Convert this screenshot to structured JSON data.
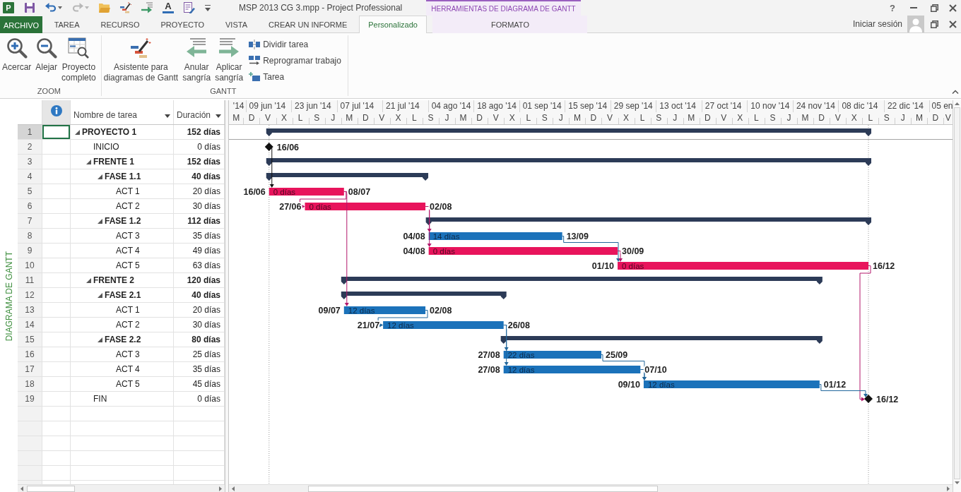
{
  "title_bar": {
    "quick_access": [
      {
        "kind": "app",
        "glyph": "P",
        "disabled": false
      },
      {
        "kind": "save",
        "disabled": false
      },
      {
        "kind": "undo",
        "disabled": false
      },
      {
        "kind": "redo",
        "disabled": true
      },
      {
        "kind": "open",
        "disabled": false
      },
      {
        "kind": "wizard",
        "disabled": false
      },
      {
        "kind": "indent",
        "disabled": false
      },
      {
        "kind": "fontcolor",
        "glyph": "A",
        "disabled": false
      },
      {
        "kind": "form",
        "disabled": false
      },
      {
        "kind": "customize",
        "disabled": false
      }
    ],
    "title": "MSP 2013 CG 3.mpp - Project Professional",
    "context_header": "HERRAMIENTAS DE DIAGRAMA DE GANTT",
    "help": "?"
  },
  "tabs": [
    {
      "label": "ARCHIVO",
      "kind": "file",
      "selected": false
    },
    {
      "label": "TAREA",
      "kind": "main",
      "selected": false
    },
    {
      "label": "RECURSO",
      "kind": "main",
      "selected": false
    },
    {
      "label": "PROYECTO",
      "kind": "main",
      "selected": false
    },
    {
      "label": "VISTA",
      "kind": "main",
      "selected": false
    },
    {
      "label": "CREAR UN INFORME",
      "kind": "main",
      "selected": false
    },
    {
      "label": "Personalizado",
      "kind": "main",
      "selected": true
    },
    {
      "label": "FORMATO",
      "kind": "context",
      "selected": false
    }
  ],
  "account": {
    "label": "Iniciar sesión"
  },
  "ribbon": {
    "groups": [
      {
        "label": "ZOOM",
        "buttons": [
          {
            "kind": "zoomin",
            "label": "Acercar"
          },
          {
            "kind": "zoomout",
            "label": "Alejar"
          },
          {
            "kind": "fit",
            "label": "Proyecto\ncompleto"
          }
        ]
      },
      {
        "label": "GANTT",
        "buttons": [
          {
            "kind": "wizard",
            "label": "Asistente para\ndiagramas de Gantt"
          },
          {
            "kind": "outdent",
            "label": "Anular\nsangría"
          },
          {
            "kind": "indent",
            "label": "Aplicar\nsangría"
          }
        ],
        "small_buttons": [
          {
            "kind": "split",
            "label": "Dividir tarea"
          },
          {
            "kind": "reschedule",
            "label": "Reprogramar trabajo"
          },
          {
            "kind": "task",
            "label": "Tarea"
          }
        ]
      }
    ]
  },
  "view_bar": {
    "label": "DIAGRAMA DE GANTT"
  },
  "table": {
    "columns": [
      {
        "kind": "info"
      },
      {
        "kind": "name",
        "label": "Nombre de tarea"
      },
      {
        "kind": "duration",
        "label": "Duración"
      }
    ]
  },
  "gantt": {
    "timescale": {
      "top": [
        "'14",
        "09 jun '14",
        "23 jun '14",
        "07 jul '14",
        "21 jul '14",
        "04 ago '14",
        "18 ago '14",
        "01 sep '14",
        "15 sep '14",
        "29 sep '14",
        "13 oct '14",
        "27 oct '14",
        "10 nov '14",
        "24 nov '14",
        "08 dic '14",
        "22 dic '14",
        "05 en"
      ],
      "bottom": [
        "M",
        "D",
        "V",
        "X",
        "L",
        "S",
        "J",
        "M",
        "D",
        "V",
        "X",
        "L",
        "S",
        "J",
        "M",
        "D",
        "V",
        "X",
        "L",
        "S",
        "J",
        "M",
        "D",
        "V",
        "X",
        "L",
        "S",
        "J",
        "M",
        "D",
        "V",
        "X",
        "L",
        "S",
        "J",
        "M",
        "D",
        "V",
        "X",
        "L",
        "S",
        "J",
        "M",
        "D",
        "V"
      ]
    }
  },
  "tasks": [
    {
      "row": "1",
      "kind": "summary",
      "name": "PROYECTO 1",
      "duration": "152 días",
      "expanded": true,
      "selected": true,
      "children": [
        {
          "row": "2",
          "kind": "milestone",
          "name": "INICIO",
          "duration": "0 días",
          "date_label": "16/06",
          "selected": false
        },
        {
          "row": "3",
          "kind": "summary",
          "name": "FRENTE 1",
          "duration": "152 días",
          "expanded": true,
          "selected": false,
          "children": [
            {
              "row": "4",
              "kind": "summary",
              "name": "FASE 1.1",
              "duration": "40 días",
              "expanded": true,
              "selected": false,
              "children": [
                {
                  "row": "5",
                  "kind": "task",
                  "name": "ACT 1",
                  "duration": "20 días",
                  "critical": true,
                  "start_label": "16/06",
                  "bar_text": "0 días",
                  "finish_label": "08/07",
                  "selected": false
                },
                {
                  "row": "6",
                  "kind": "task",
                  "name": "ACT 2",
                  "duration": "30 días",
                  "critical": true,
                  "start_label": "27/06",
                  "bar_text": "0 días",
                  "finish_label": "02/08",
                  "selected": false
                }
              ]
            },
            {
              "row": "7",
              "kind": "summary",
              "name": "FASE 1.2",
              "duration": "112 días",
              "expanded": true,
              "selected": false,
              "children": [
                {
                  "row": "8",
                  "kind": "task",
                  "name": "ACT 3",
                  "duration": "35 días",
                  "critical": false,
                  "start_label": "04/08",
                  "bar_text": "14 días",
                  "finish_label": "13/09",
                  "selected": false
                },
                {
                  "row": "9",
                  "kind": "task",
                  "name": "ACT 4",
                  "duration": "49 días",
                  "critical": true,
                  "start_label": "04/08",
                  "bar_text": "0 días",
                  "finish_label": "30/09",
                  "selected": false
                },
                {
                  "row": "10",
                  "kind": "task",
                  "name": "ACT 5",
                  "duration": "63 días",
                  "critical": true,
                  "start_label": "01/10",
                  "bar_text": "0 días",
                  "finish_label": "16/12",
                  "selected": false
                }
              ]
            }
          ]
        },
        {
          "row": "11",
          "kind": "summary",
          "name": "FRENTE 2",
          "duration": "120 días",
          "expanded": true,
          "selected": false,
          "children": [
            {
              "row": "12",
              "kind": "summary",
              "name": "FASE 2.1",
              "duration": "40 días",
              "expanded": true,
              "selected": false,
              "children": [
                {
                  "row": "13",
                  "kind": "task",
                  "name": "ACT 1",
                  "duration": "20 días",
                  "critical": false,
                  "start_label": "09/07",
                  "bar_text": "12 días",
                  "finish_label": "02/08",
                  "selected": false
                },
                {
                  "row": "14",
                  "kind": "task",
                  "name": "ACT 2",
                  "duration": "30 días",
                  "critical": false,
                  "start_label": "21/07",
                  "bar_text": "12 días",
                  "finish_label": "26/08",
                  "selected": false
                }
              ]
            },
            {
              "row": "15",
              "kind": "summary",
              "name": "FASE 2.2",
              "duration": "80 días",
              "expanded": true,
              "selected": false,
              "children": [
                {
                  "row": "16",
                  "kind": "task",
                  "name": "ACT 3",
                  "duration": "25 días",
                  "critical": false,
                  "start_label": "27/08",
                  "bar_text": "22 días",
                  "finish_label": "25/09",
                  "selected": false
                },
                {
                  "row": "17",
                  "kind": "task",
                  "name": "ACT 4",
                  "duration": "35 días",
                  "critical": false,
                  "start_label": "27/08",
                  "bar_text": "12 días",
                  "finish_label": "07/10",
                  "selected": false
                },
                {
                  "row": "18",
                  "kind": "task",
                  "name": "ACT 5",
                  "duration": "45 días",
                  "critical": false,
                  "start_label": "09/10",
                  "bar_text": "12 días",
                  "finish_label": "01/12",
                  "selected": false
                }
              ]
            }
          ]
        },
        {
          "row": "19",
          "kind": "milestone",
          "name": "FIN",
          "duration": "0 días",
          "date_label": "16/12",
          "selected": false
        }
      ]
    }
  ]
}
